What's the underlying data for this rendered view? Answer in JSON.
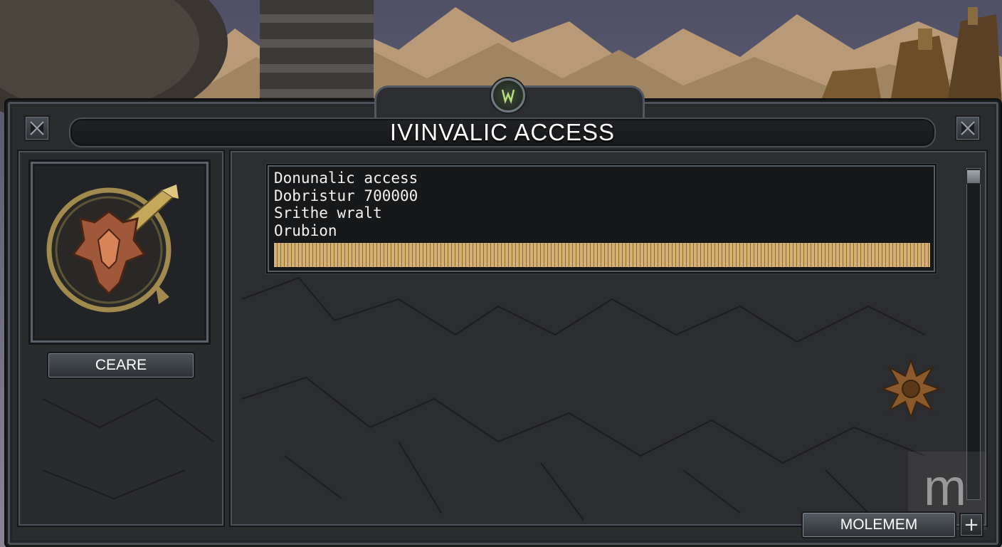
{
  "window": {
    "title": "IVINVALIC ACCESS"
  },
  "left_panel": {
    "button_label": "CEARE"
  },
  "info_panel": {
    "lines": [
      "Donunalic access",
      "Dobristur 700000",
      "Srithe wralt",
      "Orubion"
    ],
    "progress_fraction": 1.0
  },
  "footer": {
    "button_label": "MOLEMEM",
    "plus_label": "+"
  },
  "watermark": "m",
  "colors": {
    "panel": "#2b2c2e",
    "frame": "#4c5258",
    "progress": "#d5b174",
    "emblem_glow": "#b7e07a"
  }
}
